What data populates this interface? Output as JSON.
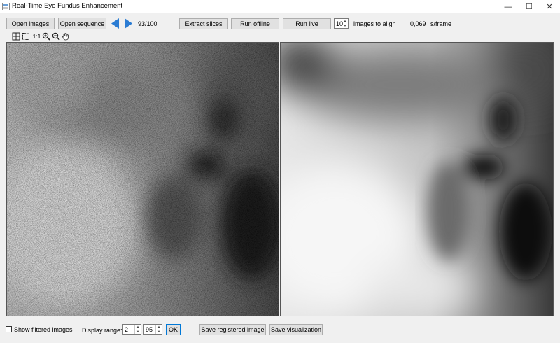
{
  "window": {
    "title": "Real-Time Eye Fundus Enhancement"
  },
  "toolbar": {
    "open_images": "Open images",
    "open_sequence": "Open sequence",
    "frame_counter": "93/100",
    "extract_slices": "Extract slices",
    "run_offline": "Run offline",
    "run_live": "Run live",
    "align_count": "10",
    "align_label": "images to align",
    "timing_value": "0,069",
    "timing_unit": "s/frame"
  },
  "viewer_tools": {
    "zoom_1to1": "1:1",
    "icons": [
      "fit-to-window-icon",
      "select-region-icon",
      "zoom-in-icon",
      "zoom-out-icon",
      "pan-hand-icon"
    ]
  },
  "bottom": {
    "show_filtered": "Show filtered images",
    "show_filtered_checked": false,
    "display_range_label": "Display range:",
    "range_min": "2",
    "range_max": "95",
    "ok": "OK",
    "save_registered": "Save registered image",
    "save_visualization": "Save visualization"
  },
  "colors": {
    "accent_arrow": "#2b7cd3",
    "window_bg": "#f0f0f0",
    "button_bg": "#e1e1e1",
    "ok_border": "#0078d7"
  }
}
